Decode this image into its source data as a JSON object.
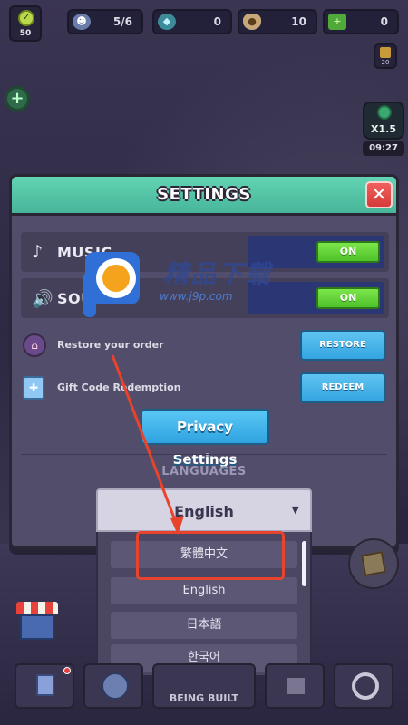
{
  "hud": {
    "level": "50",
    "workers": "5/6",
    "gems": "0",
    "wood": "10",
    "blocks": "0",
    "lock_level": "20",
    "speed": "X1.5",
    "timer": "09:27"
  },
  "dialog": {
    "title": "SETTINGS",
    "close_symbol": "✕",
    "music": {
      "label": "MUSIC",
      "state": "ON"
    },
    "sound": {
      "label": "SOUND",
      "state": "ON"
    },
    "restore": {
      "text": "Restore your order",
      "button": "RESTORE"
    },
    "redeem": {
      "text": "Gift Code Redemption",
      "button": "REDEEM"
    },
    "privacy_button": "Privacy Settings",
    "languages_title": "LANGUAGES",
    "language_selected": "English",
    "language_options": [
      "繁體中文",
      "English",
      "日本語",
      "한국어"
    ]
  },
  "watermark": {
    "brand": "精品下载",
    "url": "www.j9p.com"
  },
  "bottombar": {
    "build_label": "BEING BUILT"
  },
  "colors": {
    "header_teal": "#55c6a8",
    "toggle_green": "#62d43a",
    "button_blue": "#41b0e8",
    "close_red": "#e04c4a",
    "annotation_red": "#e8432c"
  },
  "icons": {
    "music": "music-note-icon",
    "sound": "speaker-icon",
    "restore": "basket-icon",
    "redeem": "gift-icon",
    "close": "close-icon",
    "caret": "chevron-down-icon"
  }
}
